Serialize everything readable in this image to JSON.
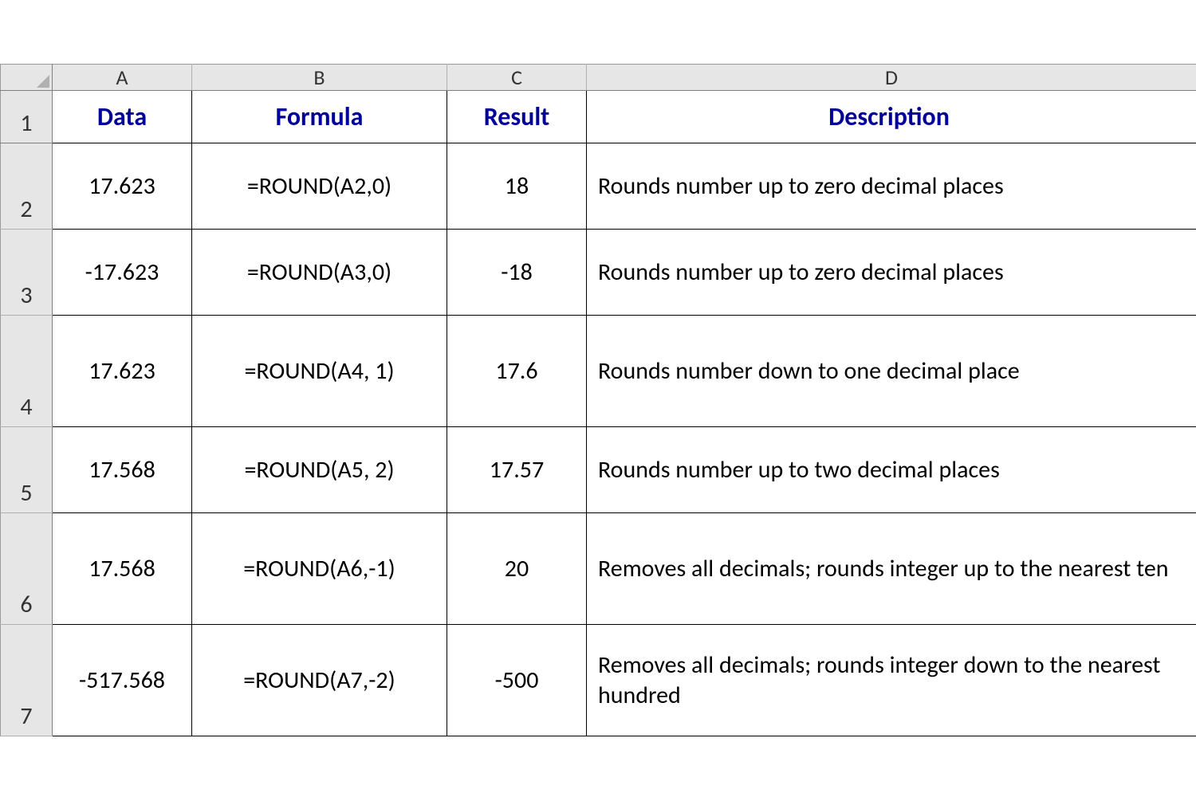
{
  "columns": {
    "A": "A",
    "B": "B",
    "C": "C",
    "D": "D"
  },
  "row_nums": [
    "1",
    "2",
    "3",
    "4",
    "5",
    "6",
    "7"
  ],
  "headers": {
    "data": "Data",
    "formula": "Formula",
    "result": "Result",
    "description": "Description"
  },
  "rows": [
    {
      "data": "17.623",
      "formula": "=ROUND(A2,0)",
      "result": "18",
      "description": "Rounds number up to zero decimal places"
    },
    {
      "data": "-17.623",
      "formula": "=ROUND(A3,0)",
      "result": "-18",
      "description": "Rounds number up to zero decimal places"
    },
    {
      "data": "17.623",
      "formula": "=ROUND(A4, 1)",
      "result": "17.6",
      "description": "Rounds number down to one decimal place"
    },
    {
      "data": "17.568",
      "formula": "=ROUND(A5, 2)",
      "result": "17.57",
      "description": "Rounds number up to two decimal places"
    },
    {
      "data": "17.568",
      "formula": "=ROUND(A6,-1)",
      "result": "20",
      "description": "Removes all decimals; rounds integer up to the nearest ten"
    },
    {
      "data": "-517.568",
      "formula": "=ROUND(A7,-2)",
      "result": "-500",
      "description": "Removes all decimals; rounds integer down to the nearest hundred"
    }
  ]
}
